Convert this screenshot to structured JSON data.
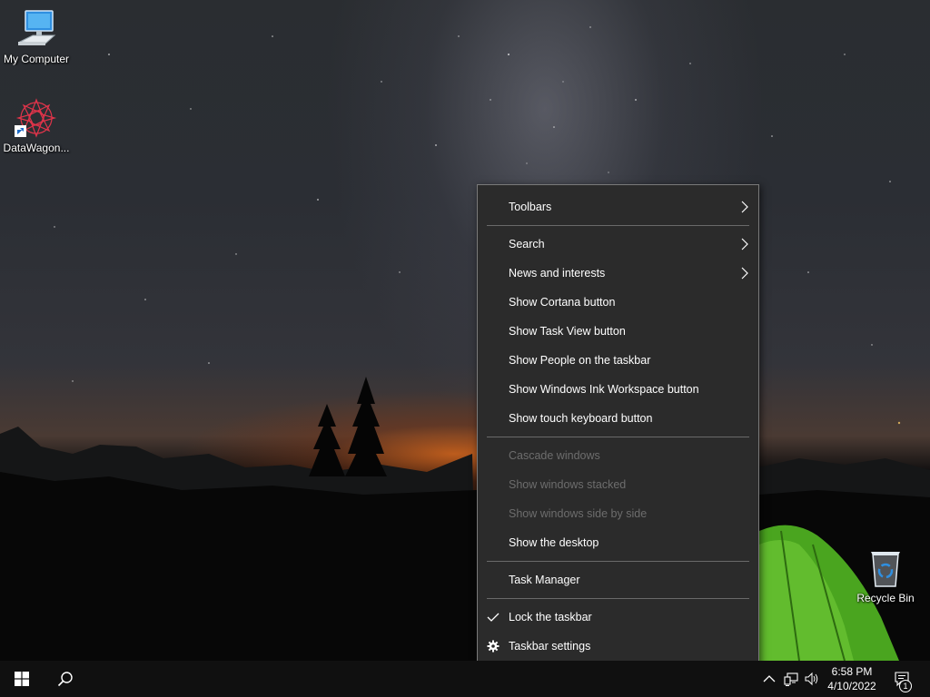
{
  "desktop": {
    "icons": [
      {
        "label": "My Computer"
      },
      {
        "label": "DataWagon..."
      },
      {
        "label": "Recycle Bin"
      }
    ]
  },
  "context_menu": {
    "items": [
      {
        "label": "Toolbars",
        "submenu": true
      },
      {
        "label": "Search",
        "submenu": true
      },
      {
        "label": "News and interests",
        "submenu": true
      },
      {
        "label": "Show Cortana button"
      },
      {
        "label": "Show Task View button"
      },
      {
        "label": "Show People on the taskbar"
      },
      {
        "label": "Show Windows Ink Workspace button"
      },
      {
        "label": "Show touch keyboard button"
      },
      {
        "label": "Cascade windows",
        "disabled": true
      },
      {
        "label": "Show windows stacked",
        "disabled": true
      },
      {
        "label": "Show windows side by side",
        "disabled": true
      },
      {
        "label": "Show the desktop"
      },
      {
        "label": "Task Manager"
      },
      {
        "label": "Lock the taskbar",
        "checked": true
      },
      {
        "label": "Taskbar settings",
        "icon": "gear-icon"
      }
    ]
  },
  "taskbar": {
    "clock": {
      "time": "6:58 PM",
      "date": "4/10/2022"
    },
    "notification_count": "1"
  },
  "colors": {
    "menu_bg": "#2b2b2b",
    "menu_border": "#7a7a7a",
    "taskbar_bg": "#101010",
    "disabled_text": "#6d6d6d"
  }
}
